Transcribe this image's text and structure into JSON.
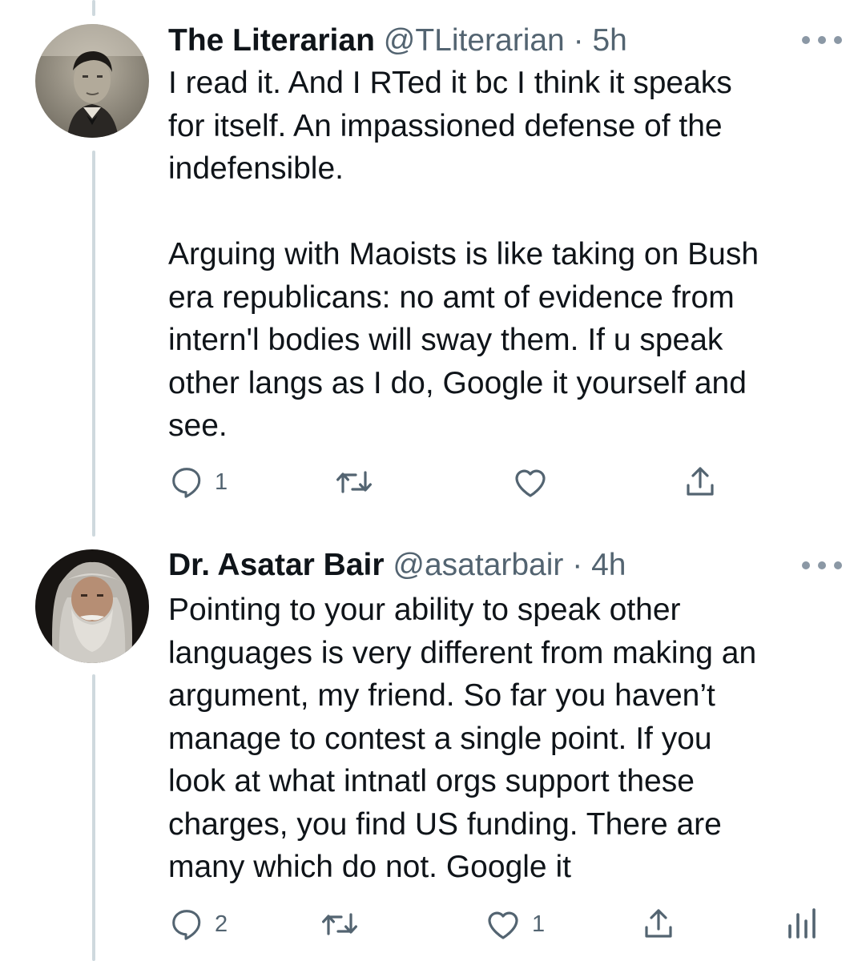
{
  "tweets": [
    {
      "display_name": "The Literarian",
      "handle": "@TLiterarian",
      "separator": "·",
      "time": "5h",
      "text": "I read it. And I RTed it bc I think it speaks\nfor itself. An impassioned defense of the\nindefensible.\n\nArguing with Maoists is like taking on Bush\nera republicans: no amt of evidence from\nintern'l bodies will sway them. If u speak\nother langs as I do, Google it yourself and\nsee.",
      "reply_count": "1",
      "retweet_count": "",
      "like_count": ""
    },
    {
      "display_name": "Dr. Asatar Bair",
      "handle": "@asatarbair",
      "separator": "·",
      "time": "4h",
      "text": "Pointing to your ability to speak other\nlanguages is very different from making an\nargument, my friend. So far you haven’t\nmanage to contest a single point. If you\nlook at what intnatl orgs support these\ncharges, you find US funding. There are\nmany which do not. Google it",
      "reply_count": "2",
      "retweet_count": "",
      "like_count": "1"
    }
  ],
  "colors": {
    "icon": "#536471",
    "thread_line": "#cfd9de",
    "text": "#0f1419"
  },
  "icons": [
    "reply-icon",
    "retweet-icon",
    "like-icon",
    "share-icon",
    "analytics-icon",
    "more-icon"
  ]
}
